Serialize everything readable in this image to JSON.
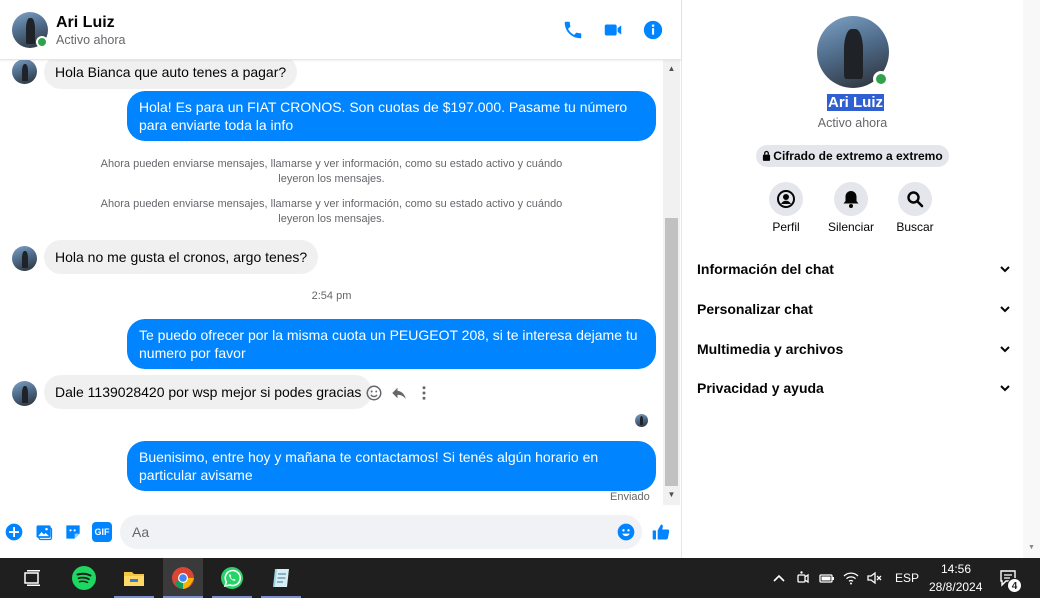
{
  "colors": {
    "accent": "#0084ff",
    "outgoing_bubble": "#0084ff",
    "incoming_bubble": "#f0f0f0",
    "online": "#31a24c",
    "taskbar": "#1f1f1f",
    "selection": "#2f5fd0"
  },
  "header": {
    "name": "Ari Luiz",
    "status": "Activo ahora",
    "icons": [
      "phone-icon",
      "video-icon",
      "info-icon"
    ]
  },
  "messages": {
    "incoming_1": "Hola Bianca que auto tenes a pagar?",
    "outgoing_1": "Hola! Es para un FIAT CRONOS. Son cuotas de $197.000. Pasame tu número para enviarte toda la info",
    "system_1": "Ahora pueden enviarse mensajes, llamarse y ver información, como su estado activo y cuándo leyeron los mensajes.",
    "system_2": "Ahora pueden enviarse mensajes, llamarse y ver información, como su estado activo y cuándo leyeron los mensajes.",
    "incoming_2": "Hola no me gusta el cronos, argo tenes?",
    "time_separator": "2:54 pm",
    "outgoing_2": "Te puedo ofrecer por la misma cuota un PEUGEOT 208, si te interesa dejame tu numero por favor",
    "incoming_3": "Dale 1139028420 por wsp mejor si podes gracias",
    "outgoing_3": "Buenisimo, entre hoy y mañana te contactamos! Si tenés algún horario en particular avisame",
    "sent_status": "Enviado",
    "hover_actions": [
      "emoji-react-icon",
      "reply-icon",
      "more-options-icon"
    ]
  },
  "composer": {
    "placeholder": "Aa",
    "value": "",
    "icons": [
      "add-icon",
      "image-icon",
      "sticker-icon",
      "gif-icon",
      "emoji-icon",
      "like-icon"
    ],
    "gif_label": "GIF"
  },
  "panel": {
    "name": "Ari Luiz",
    "status": "Activo ahora",
    "encryption": "Cifrado de extremo a extremo",
    "actions": [
      {
        "label": "Perfil",
        "icon": "profile-icon"
      },
      {
        "label": "Silenciar",
        "icon": "bell-icon"
      },
      {
        "label": "Buscar",
        "icon": "search-icon"
      }
    ],
    "sections": [
      {
        "label": "Información del chat"
      },
      {
        "label": "Personalizar chat"
      },
      {
        "label": "Multimedia y archivos"
      },
      {
        "label": "Privacidad y ayuda"
      }
    ]
  },
  "taskbar": {
    "apps": [
      "task-view-icon",
      "spotify-icon",
      "file-explorer-icon",
      "chrome-icon",
      "whatsapp-icon",
      "notes-app-icon"
    ],
    "language": "ESP",
    "time": "14:56",
    "date": "28/8/2024",
    "notification_count": "4"
  }
}
